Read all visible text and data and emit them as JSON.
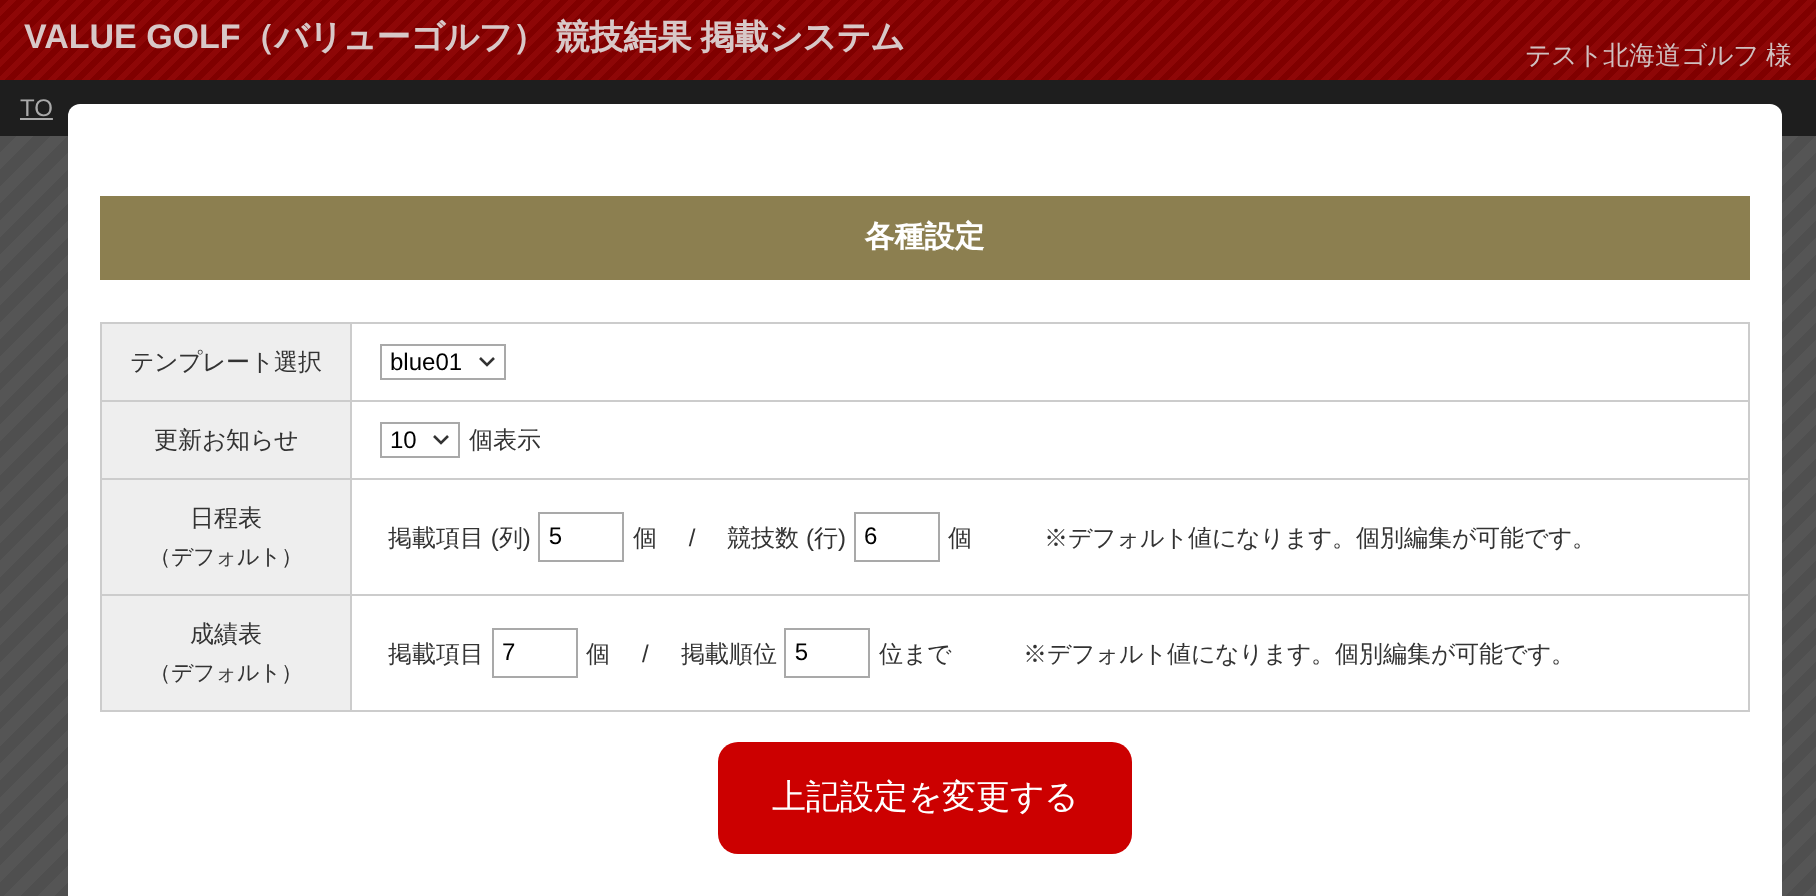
{
  "header": {
    "title": "VALUE GOLF（バリューゴルフ） 競技結果 掲載システム",
    "user": "テスト北海道ゴルフ 様"
  },
  "nav": {
    "link": "TO"
  },
  "modal": {
    "title": "各種設定",
    "rows": [
      {
        "label": "テンプレート選択",
        "parts": [
          {
            "kind": "select",
            "value": "blue01"
          }
        ]
      },
      {
        "label": "更新お知らせ",
        "parts": [
          {
            "kind": "select",
            "value": "10"
          },
          {
            "kind": "text",
            "text": "個表示"
          }
        ]
      },
      {
        "label": "日程表",
        "sublabel": "（デフォルト）",
        "parts": [
          {
            "kind": "text",
            "text": "掲載項目 (列)"
          },
          {
            "kind": "input",
            "value": "5"
          },
          {
            "kind": "text",
            "text": "個"
          },
          {
            "kind": "sep",
            "text": "/"
          },
          {
            "kind": "text",
            "text": "競技数 (行)"
          },
          {
            "kind": "input",
            "value": "6"
          },
          {
            "kind": "text",
            "text": "個"
          },
          {
            "kind": "note",
            "text": "※デフォルト値になります。個別編集が可能です。"
          }
        ]
      },
      {
        "label": "成績表",
        "sublabel": "（デフォルト）",
        "parts": [
          {
            "kind": "text",
            "text": "掲載項目"
          },
          {
            "kind": "input",
            "value": "7"
          },
          {
            "kind": "text",
            "text": "個"
          },
          {
            "kind": "sep",
            "text": "/"
          },
          {
            "kind": "text",
            "text": "掲載順位"
          },
          {
            "kind": "input",
            "value": "5"
          },
          {
            "kind": "text",
            "text": "位まで"
          },
          {
            "kind": "note",
            "text": "※デフォルト値になります。個別編集が可能です。"
          }
        ]
      }
    ],
    "button": "上記設定を変更する"
  }
}
